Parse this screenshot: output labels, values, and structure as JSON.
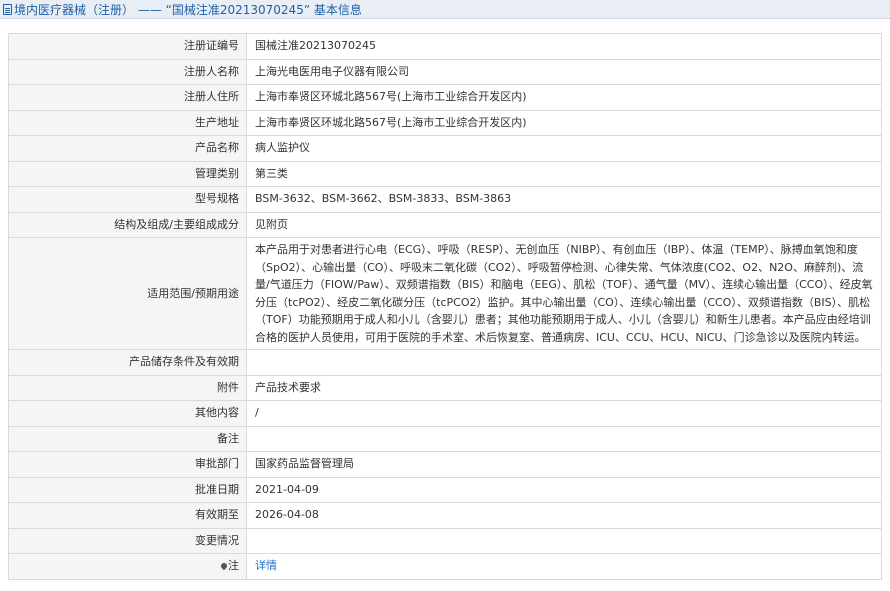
{
  "header": {
    "icon": "document-icon",
    "title": "境内医疗器械（注册） —— “国械注准20213070245” 基本信息"
  },
  "rows": [
    {
      "label": "注册证编号",
      "value": "国械注准20213070245"
    },
    {
      "label": "注册人名称",
      "value": "上海光电医用电子仪器有限公司"
    },
    {
      "label": "注册人住所",
      "value": "上海市奉贤区环城北路567号(上海市工业综合开发区内)"
    },
    {
      "label": "生产地址",
      "value": "上海市奉贤区环城北路567号(上海市工业综合开发区内)"
    },
    {
      "label": "产品名称",
      "value": "病人监护仪"
    },
    {
      "label": "管理类别",
      "value": "第三类"
    },
    {
      "label": "型号规格",
      "value": "BSM-3632、BSM-3662、BSM-3833、BSM-3863"
    },
    {
      "label": "结构及组成/主要组成成分",
      "value": "见附页"
    },
    {
      "label": "适用范围/预期用途",
      "value": "本产品用于对患者进行心电（ECG）、呼吸（RESP）、无创血压（NIBP）、有创血压（IBP）、体温（TEMP）、脉搏血氧饱和度（SpO2）、心输出量（CO）、呼吸末二氧化碳（CO2）、呼吸暂停检测、心律失常、气体浓度(CO2、O2、N2O、麻醉剂)、流量/气道压力（FlOW/Paw）、双频谱指数（BIS）和脑电（EEG）、肌松（TOF）、通气量（MV）、连续心输出量（CCO）、经皮氧分压（tcPO2）、经皮二氧化碳分压（tcPCO2）监护。其中心输出量（CO）、连续心输出量（CCO）、双频谱指数（BIS）、肌松（TOF）功能预期用于成人和小儿（含婴儿）患者；其他功能预期用于成人、小儿（含婴儿）和新生儿患者。本产品应由经培训合格的医护人员使用，可用于医院的手术室、术后恢复室、普通病房、ICU、CCU、HCU、NICU、门诊急诊以及医院内转运。"
    },
    {
      "label": "产品储存条件及有效期",
      "value": ""
    },
    {
      "label": "附件",
      "value": "产品技术要求"
    },
    {
      "label": "其他内容",
      "value": "/"
    },
    {
      "label": "备注",
      "value": ""
    },
    {
      "label": "审批部门",
      "value": "国家药品监督管理局"
    },
    {
      "label": "批准日期",
      "value": "2021-04-09"
    },
    {
      "label": "有效期至",
      "value": "2026-04-08"
    },
    {
      "label": "变更情况",
      "value": ""
    }
  ],
  "note_row": {
    "icon": "pin-icon",
    "label": "注",
    "link_text": "详情"
  }
}
